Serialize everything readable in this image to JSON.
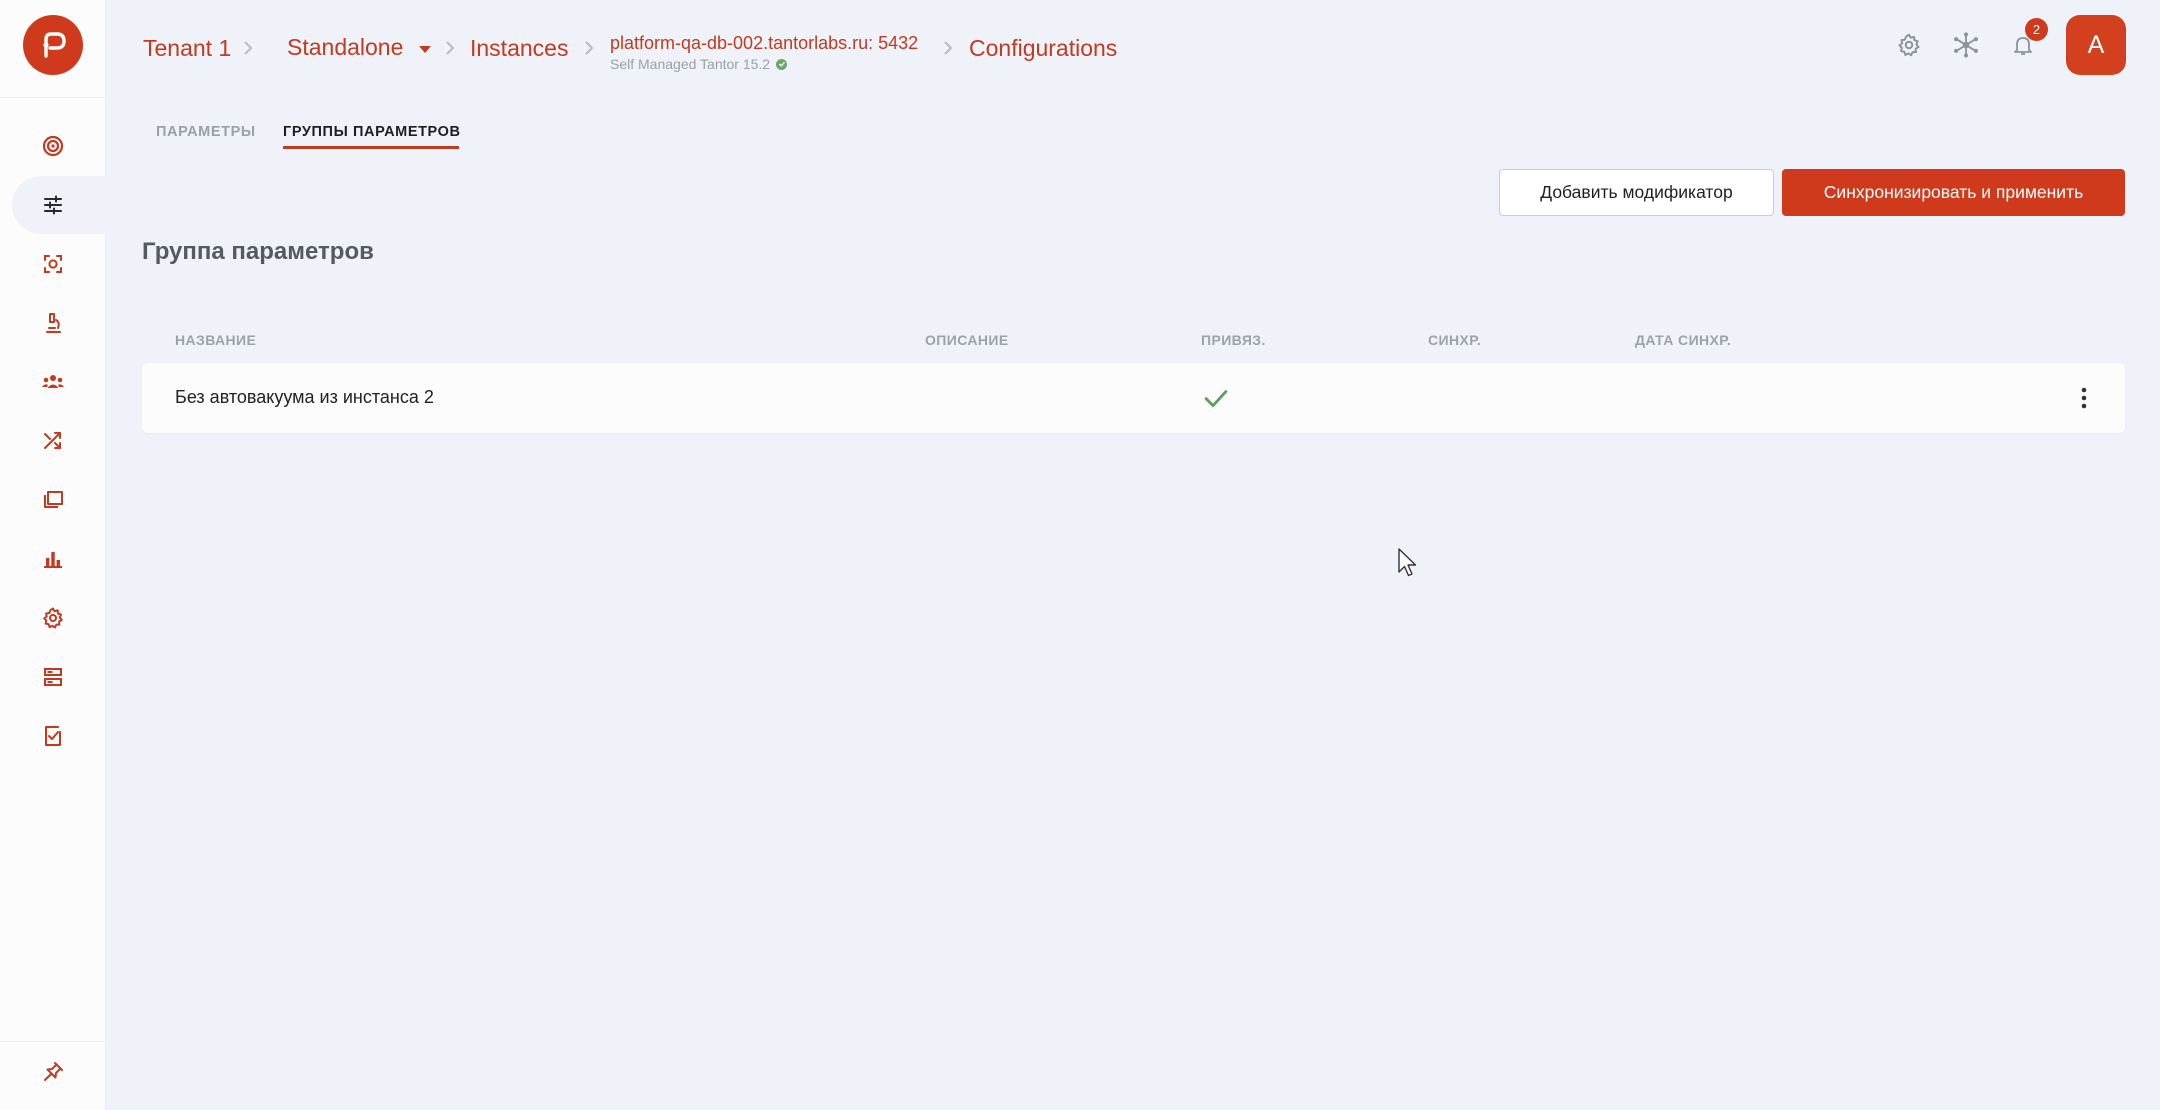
{
  "header": {
    "breadcrumbs": {
      "tenant": "Tenant 1",
      "standalone": "Standalone",
      "instances": "Instances",
      "instance": "platform-qa-db-002.tantorlabs.ru: 5432",
      "instance_sub": "Self Managed Tantor 15.2",
      "configurations": "Configurations"
    },
    "notifications_count": "2",
    "avatar_letter": "A"
  },
  "tabs": [
    {
      "label": "ПАРАМЕТРЫ",
      "active": false
    },
    {
      "label": "ГРУППЫ ПАРАМЕТРОВ",
      "active": true
    }
  ],
  "actions": {
    "add_modifier": "Добавить модификатор",
    "sync_apply": "Синхронизировать и применить"
  },
  "section_title": "Группа параметров",
  "table": {
    "columns": [
      "НАЗВАНИЕ",
      "ОПИСАНИЕ",
      "ПРИВЯЗ.",
      "СИНХР.",
      "ДАТА СИНХР."
    ],
    "rows": [
      {
        "name": "Без автовакуума из инстанса 2",
        "description": "",
        "bound": true,
        "synced": "",
        "sync_date": ""
      }
    ]
  },
  "sidebar": {
    "items": [
      "target-icon",
      "sliders-icon",
      "scan-icon",
      "microscope-icon",
      "users-icon",
      "shuffle-icon",
      "folders-icon",
      "bar-chart-icon",
      "gear-icon",
      "server-icon",
      "checklist-icon"
    ],
    "active_index": 1
  },
  "colors": {
    "accent": "#cf3a1c",
    "background": "#eff2f8",
    "success": "#5aa05a"
  }
}
